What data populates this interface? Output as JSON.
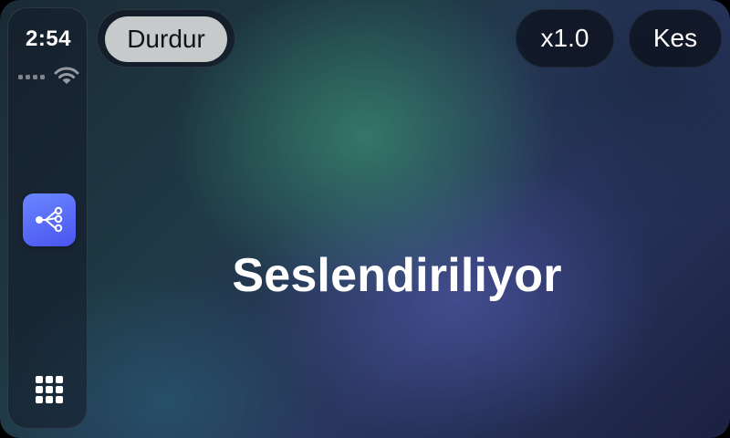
{
  "status_bar": {
    "time": "2:54",
    "signal_icon": "cellular-signal-icon",
    "wifi_icon": "wifi-icon"
  },
  "sidebar": {
    "app_icon": "share-nodes-icon",
    "app_icon_color": "#5a6cff",
    "apps_icon": "app-grid-icon"
  },
  "controls": {
    "pause_label": "Durdur",
    "speed_label": "x1.0",
    "cut_label": "Kes"
  },
  "main": {
    "status": "Seslendiriliyor"
  }
}
